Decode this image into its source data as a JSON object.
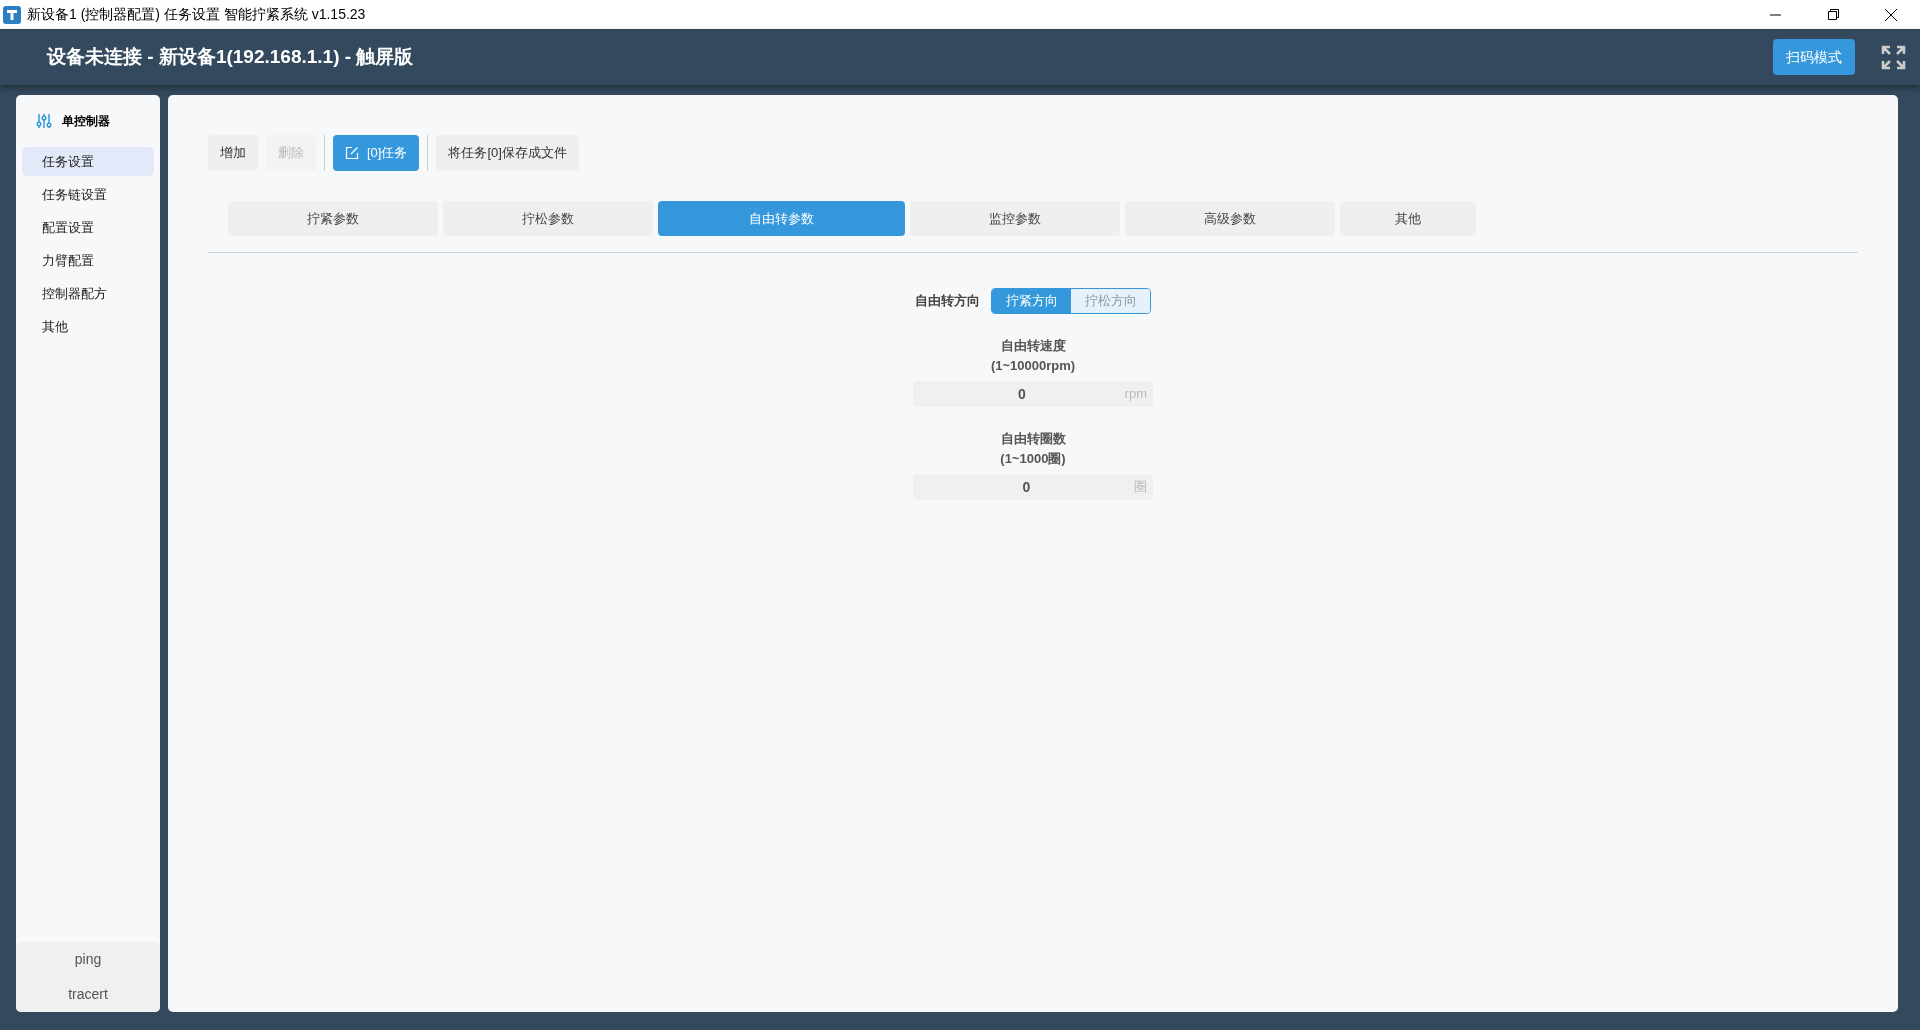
{
  "window": {
    "title": "新设备1 (控制器配置) 任务设置 智能拧紧系统 v1.15.23"
  },
  "header": {
    "title": "设备未连接 - 新设备1(192.168.1.1) - 触屏版",
    "scan_button": "扫码模式"
  },
  "sidebar": {
    "title": "单控制器",
    "items": [
      {
        "label": "任务设置",
        "selected": true
      },
      {
        "label": "任务链设置",
        "selected": false
      },
      {
        "label": "配置设置",
        "selected": false
      },
      {
        "label": "力臂配置",
        "selected": false
      },
      {
        "label": "控制器配方",
        "selected": false
      },
      {
        "label": "其他",
        "selected": false
      }
    ],
    "tools": [
      "ping",
      "tracert"
    ]
  },
  "toolbar": [
    {
      "label": "增加",
      "kind": "plain",
      "disabled": false
    },
    {
      "label": "删除",
      "kind": "plain",
      "disabled": true
    },
    {
      "label": "[0]任务",
      "kind": "primary",
      "disabled": false
    },
    {
      "label": "将任务[0]保存成文件",
      "kind": "plain",
      "disabled": false
    }
  ],
  "tabs": [
    {
      "label": "拧紧参数",
      "selected": false
    },
    {
      "label": "拧松参数",
      "selected": false
    },
    {
      "label": "自由转参数",
      "selected": true
    },
    {
      "label": "监控参数",
      "selected": false
    },
    {
      "label": "高级参数",
      "selected": false
    },
    {
      "label": "其他",
      "selected": false
    }
  ],
  "direction": {
    "label": "自由转方向",
    "options": [
      {
        "label": "拧紧方向",
        "selected": true
      },
      {
        "label": "拧松方向",
        "selected": false
      }
    ]
  },
  "fields": [
    {
      "label": "自由转速度",
      "range": "(1~10000rpm)",
      "value": "0",
      "unit": "rpm"
    },
    {
      "label": "自由转圈数",
      "range": "(1~1000圈)",
      "value": "0",
      "unit": "圈"
    }
  ]
}
